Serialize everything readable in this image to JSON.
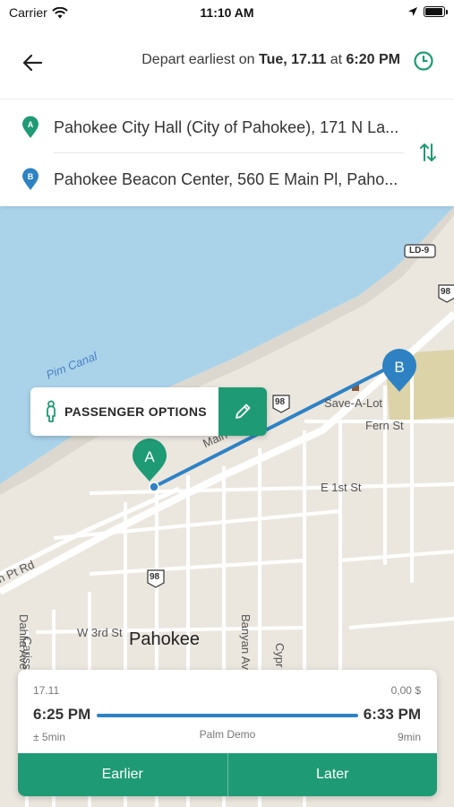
{
  "status_bar": {
    "carrier": "Carrier",
    "time": "11:10 AM",
    "battery_level": 0.95
  },
  "header": {
    "depart_prefix": "Depart earliest on ",
    "depart_date": "Tue, 17.11",
    "depart_at": " at ",
    "depart_time": "6:20 PM",
    "back_icon": "arrow-left-icon",
    "clock_icon": "clock-icon"
  },
  "locations": {
    "from": {
      "marker": "A",
      "text": "Pahokee City Hall (City of Pahokee), 171 N La..."
    },
    "to": {
      "marker": "B",
      "text": "Pahokee Beacon Center, 560 E Main Pl, Paho..."
    },
    "swap_icon": "swap-vertical-icon"
  },
  "map": {
    "labels": {
      "canal": "Pim Canal",
      "main": "Main",
      "save_a_lot": "Save-A-Lot",
      "fern": "Fern St",
      "first": "E 1st St",
      "pt_rd": "n Pt Rd",
      "third": "W 3rd St",
      "city": "Pahokee",
      "carissa": "Carissa Dr",
      "dahlia": "Dahlia Ave",
      "banyan": "Banyan Av",
      "cypr": "Cypr",
      "ld9": "LD-9",
      "hw98a": "98",
      "hw98b": "98",
      "hw98c": "98"
    },
    "markers": {
      "a": "A",
      "b": "B"
    }
  },
  "passenger_options": {
    "label": "PASSENGER OPTIONS",
    "icon": "person-icon",
    "edit_icon": "pencil-icon"
  },
  "trip": {
    "date": "17.11",
    "price": "0,00 $",
    "departure": "6:25 PM",
    "arrival": "6:33 PM",
    "tolerance": "± 5min",
    "operator": "Palm Demo",
    "duration": "9min",
    "earlier_label": "Earlier",
    "later_label": "Later"
  },
  "colors": {
    "accent": "#1e9a74",
    "route": "#2e82c4",
    "marker_a": "#1e9a74",
    "marker_b": "#2e82c4",
    "water": "#aad3ea",
    "land": "#ebe7df"
  }
}
